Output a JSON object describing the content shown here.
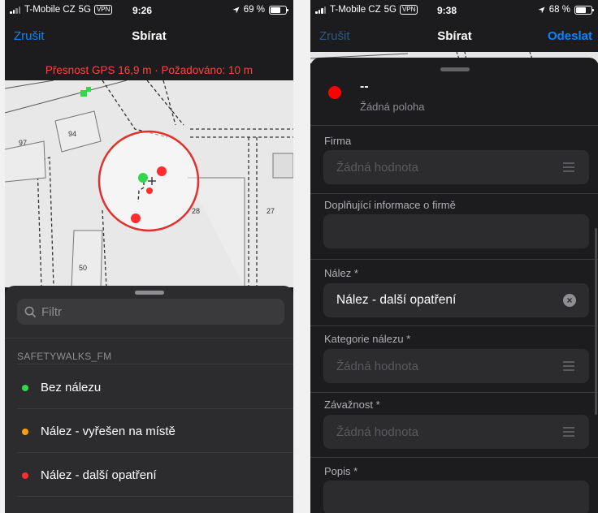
{
  "left_phone": {
    "status": {
      "carrier": "T-Mobile CZ",
      "network": "5G",
      "vpn": "VPN",
      "time": "9:26",
      "battery": "69 %",
      "battery_level": 0.69
    },
    "nav": {
      "cancel": "Zrušit",
      "title": "Sbírat"
    },
    "gps_warning": "Přesnost GPS 16,9 m · Požadováno: 10 m",
    "map_labels": [
      "94",
      "97",
      "28",
      "27",
      "50"
    ],
    "filter_placeholder": "Filtr",
    "layer_name": "SAFETYWALKS_FM",
    "items": [
      {
        "label": "Bez nálezu",
        "color": "#32d74b"
      },
      {
        "label": "Nález - vyřešen na místě",
        "color": "#ff9f0a"
      },
      {
        "label": "Nález - další opatření",
        "color": "#ff2d2d"
      }
    ],
    "icon_names": [
      "search-icon",
      "location-arrow-icon",
      "battery-icon",
      "signal-icon"
    ]
  },
  "right_phone": {
    "status": {
      "carrier": "T-Mobile CZ",
      "network": "5G",
      "vpn": "VPN",
      "time": "9:38",
      "battery": "68 %",
      "battery_level": 0.68
    },
    "nav": {
      "cancel": "Zrušit",
      "title": "Sbírat",
      "submit": "Odeslat"
    },
    "location": {
      "title": "--",
      "subtitle": "Žádná poloha"
    },
    "fields": [
      {
        "label": "Firma",
        "value": "",
        "placeholder": "Žádná hodnota",
        "type": "list"
      },
      {
        "label": "Doplňující informace o firmě",
        "value": "",
        "placeholder": "",
        "type": "text"
      },
      {
        "label": "Nález *",
        "value": "Nález - další opatření",
        "placeholder": "",
        "type": "clearable"
      },
      {
        "label": "Kategorie nálezu *",
        "value": "",
        "placeholder": "Žádná hodnota",
        "type": "list"
      },
      {
        "label": "Závažnost *",
        "value": "",
        "placeholder": "Žádná hodnota",
        "type": "list"
      },
      {
        "label": "Popis *",
        "value": "",
        "placeholder": "",
        "type": "text"
      }
    ]
  },
  "colors": {
    "accent": "#0a84ff",
    "warning": "#ff453a",
    "background": "#1c1c1e"
  }
}
